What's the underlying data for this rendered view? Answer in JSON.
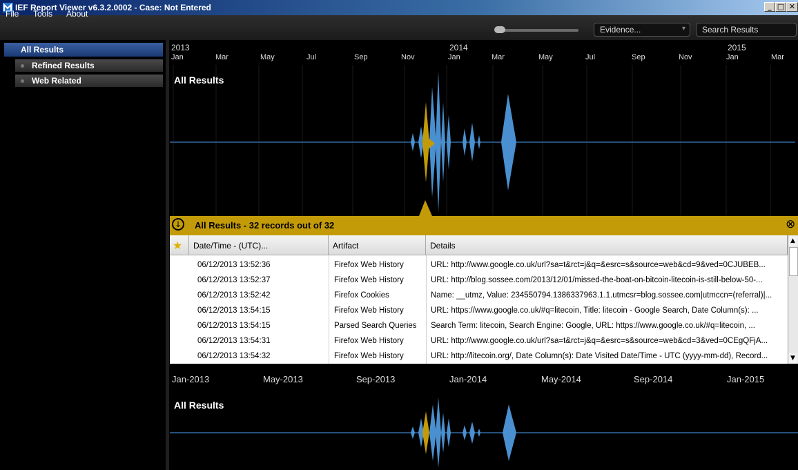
{
  "window": {
    "title": "IEF Report Viewer v6.3.2.0002 - Case: Not Entered"
  },
  "menu": {
    "items": [
      "File",
      "Tools",
      "About"
    ]
  },
  "toolbar": {
    "evidence_dropdown": "Evidence...",
    "search_dropdown": "Search Results"
  },
  "sidebar": {
    "items": [
      {
        "label": "All Results",
        "selected": true
      },
      {
        "label": "Refined Results"
      },
      {
        "label": "Web Related"
      }
    ]
  },
  "timeline": {
    "years": [
      "2013",
      "2014",
      "2015"
    ],
    "months": [
      "Jan",
      "Mar",
      "May",
      "Jul",
      "Sep",
      "Nov",
      "Jan",
      "Mar",
      "May",
      "Jul",
      "Sep",
      "Nov",
      "Jan",
      "Mar"
    ],
    "chart_title": "All Results"
  },
  "results": {
    "title": "All Results - 32 records out of 32",
    "columns": [
      "Date/Time - (UTC)...",
      "Artifact",
      "Details"
    ],
    "rows": [
      {
        "date": "06/12/2013 13:52:36",
        "artifact": "Firefox Web History",
        "details": "URL: http://www.google.co.uk/url?sa=t&rct=j&q=&esrc=s&source=web&cd=9&ved=0CJUBEB..."
      },
      {
        "date": "06/12/2013 13:52:37",
        "artifact": "Firefox Web History",
        "details": "URL: http://blog.sossee.com/2013/12/01/missed-the-boat-on-bitcoin-litecoin-is-still-below-50-..."
      },
      {
        "date": "06/12/2013 13:52:42",
        "artifact": "Firefox Cookies",
        "details": "Name: __utmz, Value: 234550794.1386337963.1.1.utmcsr=blog.sossee.com|utmccn=(referral)|..."
      },
      {
        "date": "06/12/2013 13:54:15",
        "artifact": "Firefox Web History",
        "details": "URL: https://www.google.co.uk/#q=litecoin, Title: litecoin - Google Search, Date Column(s): ..."
      },
      {
        "date": "06/12/2013 13:54:15",
        "artifact": "Parsed Search Queries",
        "details": "Search Term: litecoin, Search Engine: Google, URL: https://www.google.co.uk/#q=litecoin, ..."
      },
      {
        "date": "06/12/2013 13:54:31",
        "artifact": "Firefox Web History",
        "details": "URL: http://www.google.co.uk/url?sa=t&rct=j&q=&esrc=s&source=web&cd=3&ved=0CEgQFjA..."
      },
      {
        "date": "06/12/2013 13:54:32",
        "artifact": "Firefox Web History",
        "details": "URL: http://litecoin.org/, Date Column(s): Date Visited Date/Time - UTC (yyyy-mm-dd), Record..."
      }
    ]
  },
  "overview": {
    "axis_labels": [
      "Jan-2013",
      "May-2013",
      "Sep-2013",
      "Jan-2014",
      "May-2014",
      "Sep-2014",
      "Jan-2015"
    ],
    "chart_title": "All Results"
  },
  "colors": {
    "accent_gold": "#c39b09",
    "series_blue": "#4a90d0",
    "selection_blue": "#3a5fa0"
  }
}
